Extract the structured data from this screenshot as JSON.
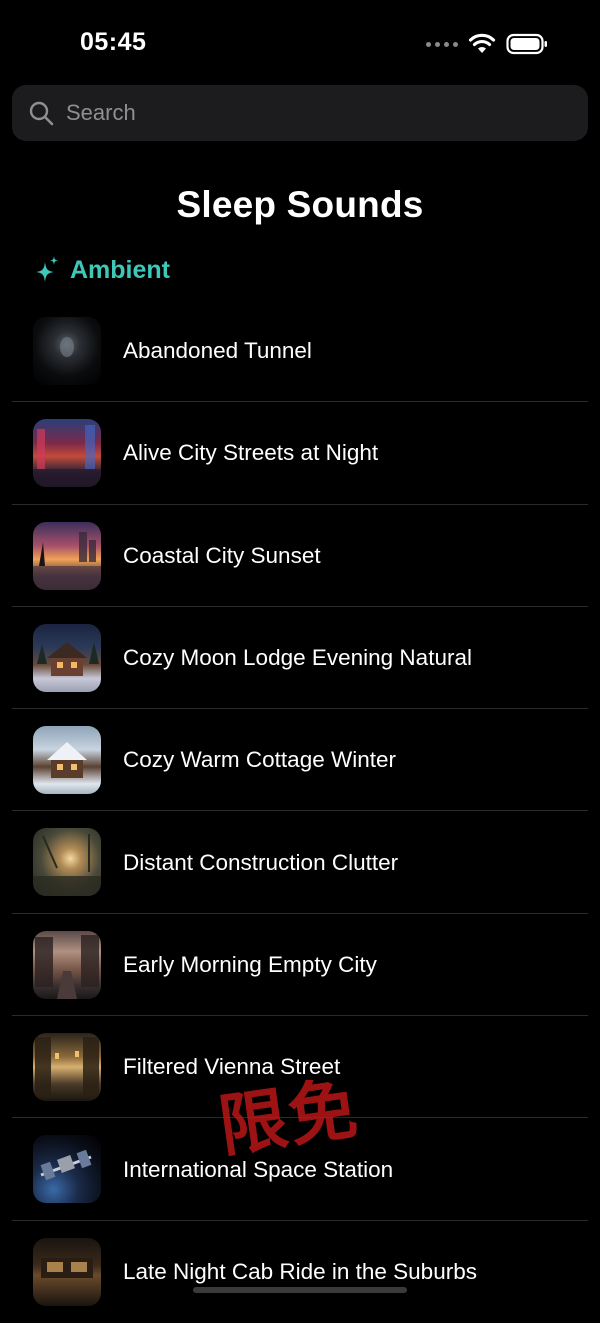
{
  "status_bar": {
    "time": "05:45"
  },
  "search": {
    "placeholder": "Search",
    "icon": "search-icon"
  },
  "page": {
    "title": "Sleep Sounds"
  },
  "section": {
    "title": "Ambient",
    "icon": "sparkle-icon",
    "accent_color": "#3fc8b8"
  },
  "sounds": [
    {
      "title": "Abandoned Tunnel"
    },
    {
      "title": "Alive City Streets at Night"
    },
    {
      "title": "Coastal City Sunset"
    },
    {
      "title": "Cozy Moon Lodge Evening Natural"
    },
    {
      "title": "Cozy Warm Cottage Winter"
    },
    {
      "title": "Distant Construction Clutter"
    },
    {
      "title": "Early Morning Empty City"
    },
    {
      "title": "Filtered Vienna Street"
    },
    {
      "title": "International Space Station"
    },
    {
      "title": "Late Night Cab Ride in the Suburbs"
    }
  ],
  "watermark": {
    "text": "限免"
  }
}
